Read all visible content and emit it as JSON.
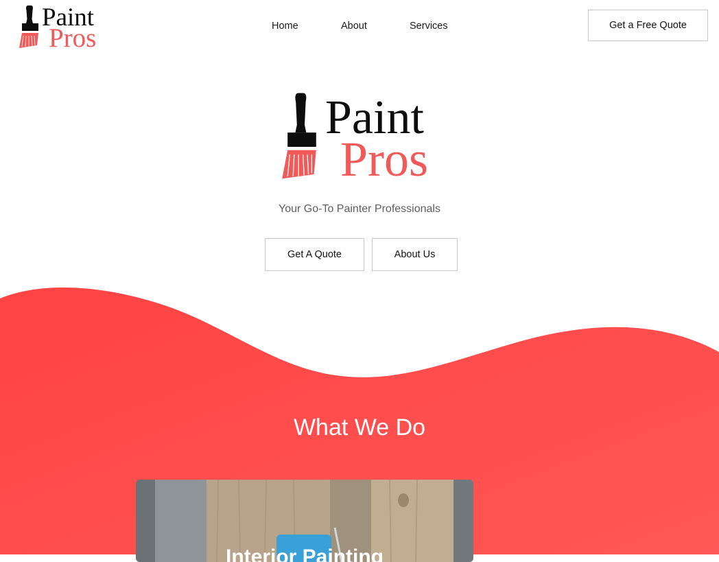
{
  "brand": {
    "name_top": "Paint",
    "name_bottom": "Pros",
    "accent_color": "#f25a5a",
    "dark_color": "#0d0d0d"
  },
  "nav": {
    "items": [
      {
        "label": "Home"
      },
      {
        "label": "About"
      },
      {
        "label": "Services"
      }
    ],
    "cta_label": "Get a Free Quote"
  },
  "hero": {
    "tagline": "Your Go-To Painter Professionals",
    "primary_button": "Get A Quote",
    "secondary_button": "About Us"
  },
  "services": {
    "title": "What We Do",
    "section_color": "#ff4a4a",
    "cards": [
      {
        "title": "Interior Painting",
        "image": "paintbrush-on-wood-photo"
      }
    ]
  }
}
